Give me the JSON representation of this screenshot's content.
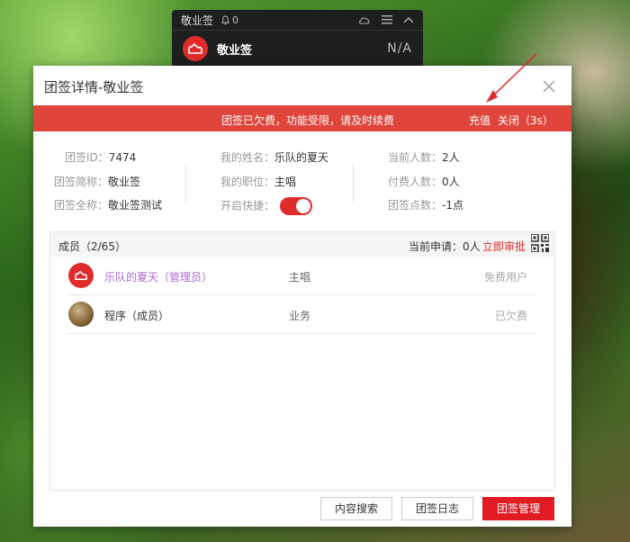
{
  "mini_widget": {
    "title": "敬业签",
    "bell_count": "0",
    "app_name": "敬业签",
    "status": "N/A"
  },
  "dialog": {
    "title": "团签详情-敬业签",
    "close_icon": "close-icon",
    "banner": {
      "message": "团签已欠费，功能受限，请及时续费",
      "recharge": "充值",
      "close": "关闭（3s）",
      "color": "#e0453c"
    },
    "info": {
      "col1": [
        {
          "label": "团签ID：",
          "value": "7474"
        },
        {
          "label": "团签简称：",
          "value": "敬业签"
        },
        {
          "label": "团签全称：",
          "value": "敬业签测试"
        }
      ],
      "col2": [
        {
          "label": "我的姓名：",
          "value": "乐队的夏天"
        },
        {
          "label": "我的职位：",
          "value": "主唱"
        },
        {
          "label": "开启快捷：",
          "value": ""
        }
      ],
      "col3": [
        {
          "label": "当前人数：",
          "value": "2人"
        },
        {
          "label": "付费人数：",
          "value": "0人"
        },
        {
          "label": "团签点数：",
          "value": "-1点"
        }
      ],
      "quick_toggle_on": true
    },
    "members": {
      "title": "成员（2/65）",
      "pending_label": "当前申请：0人",
      "approve_label": "立即审批",
      "rows": [
        {
          "name": "乐队的夏天（管理员）",
          "role": "主唱",
          "status": "免费用户",
          "name_color": "#b06ad6"
        },
        {
          "name": "程序（成员）",
          "role": "业务",
          "status": "已欠费",
          "name_color": "#333333"
        }
      ]
    },
    "buttons": {
      "search": "内容搜索",
      "log": "团签日志",
      "manage": "团签管理"
    },
    "accent": "#e01b24"
  }
}
